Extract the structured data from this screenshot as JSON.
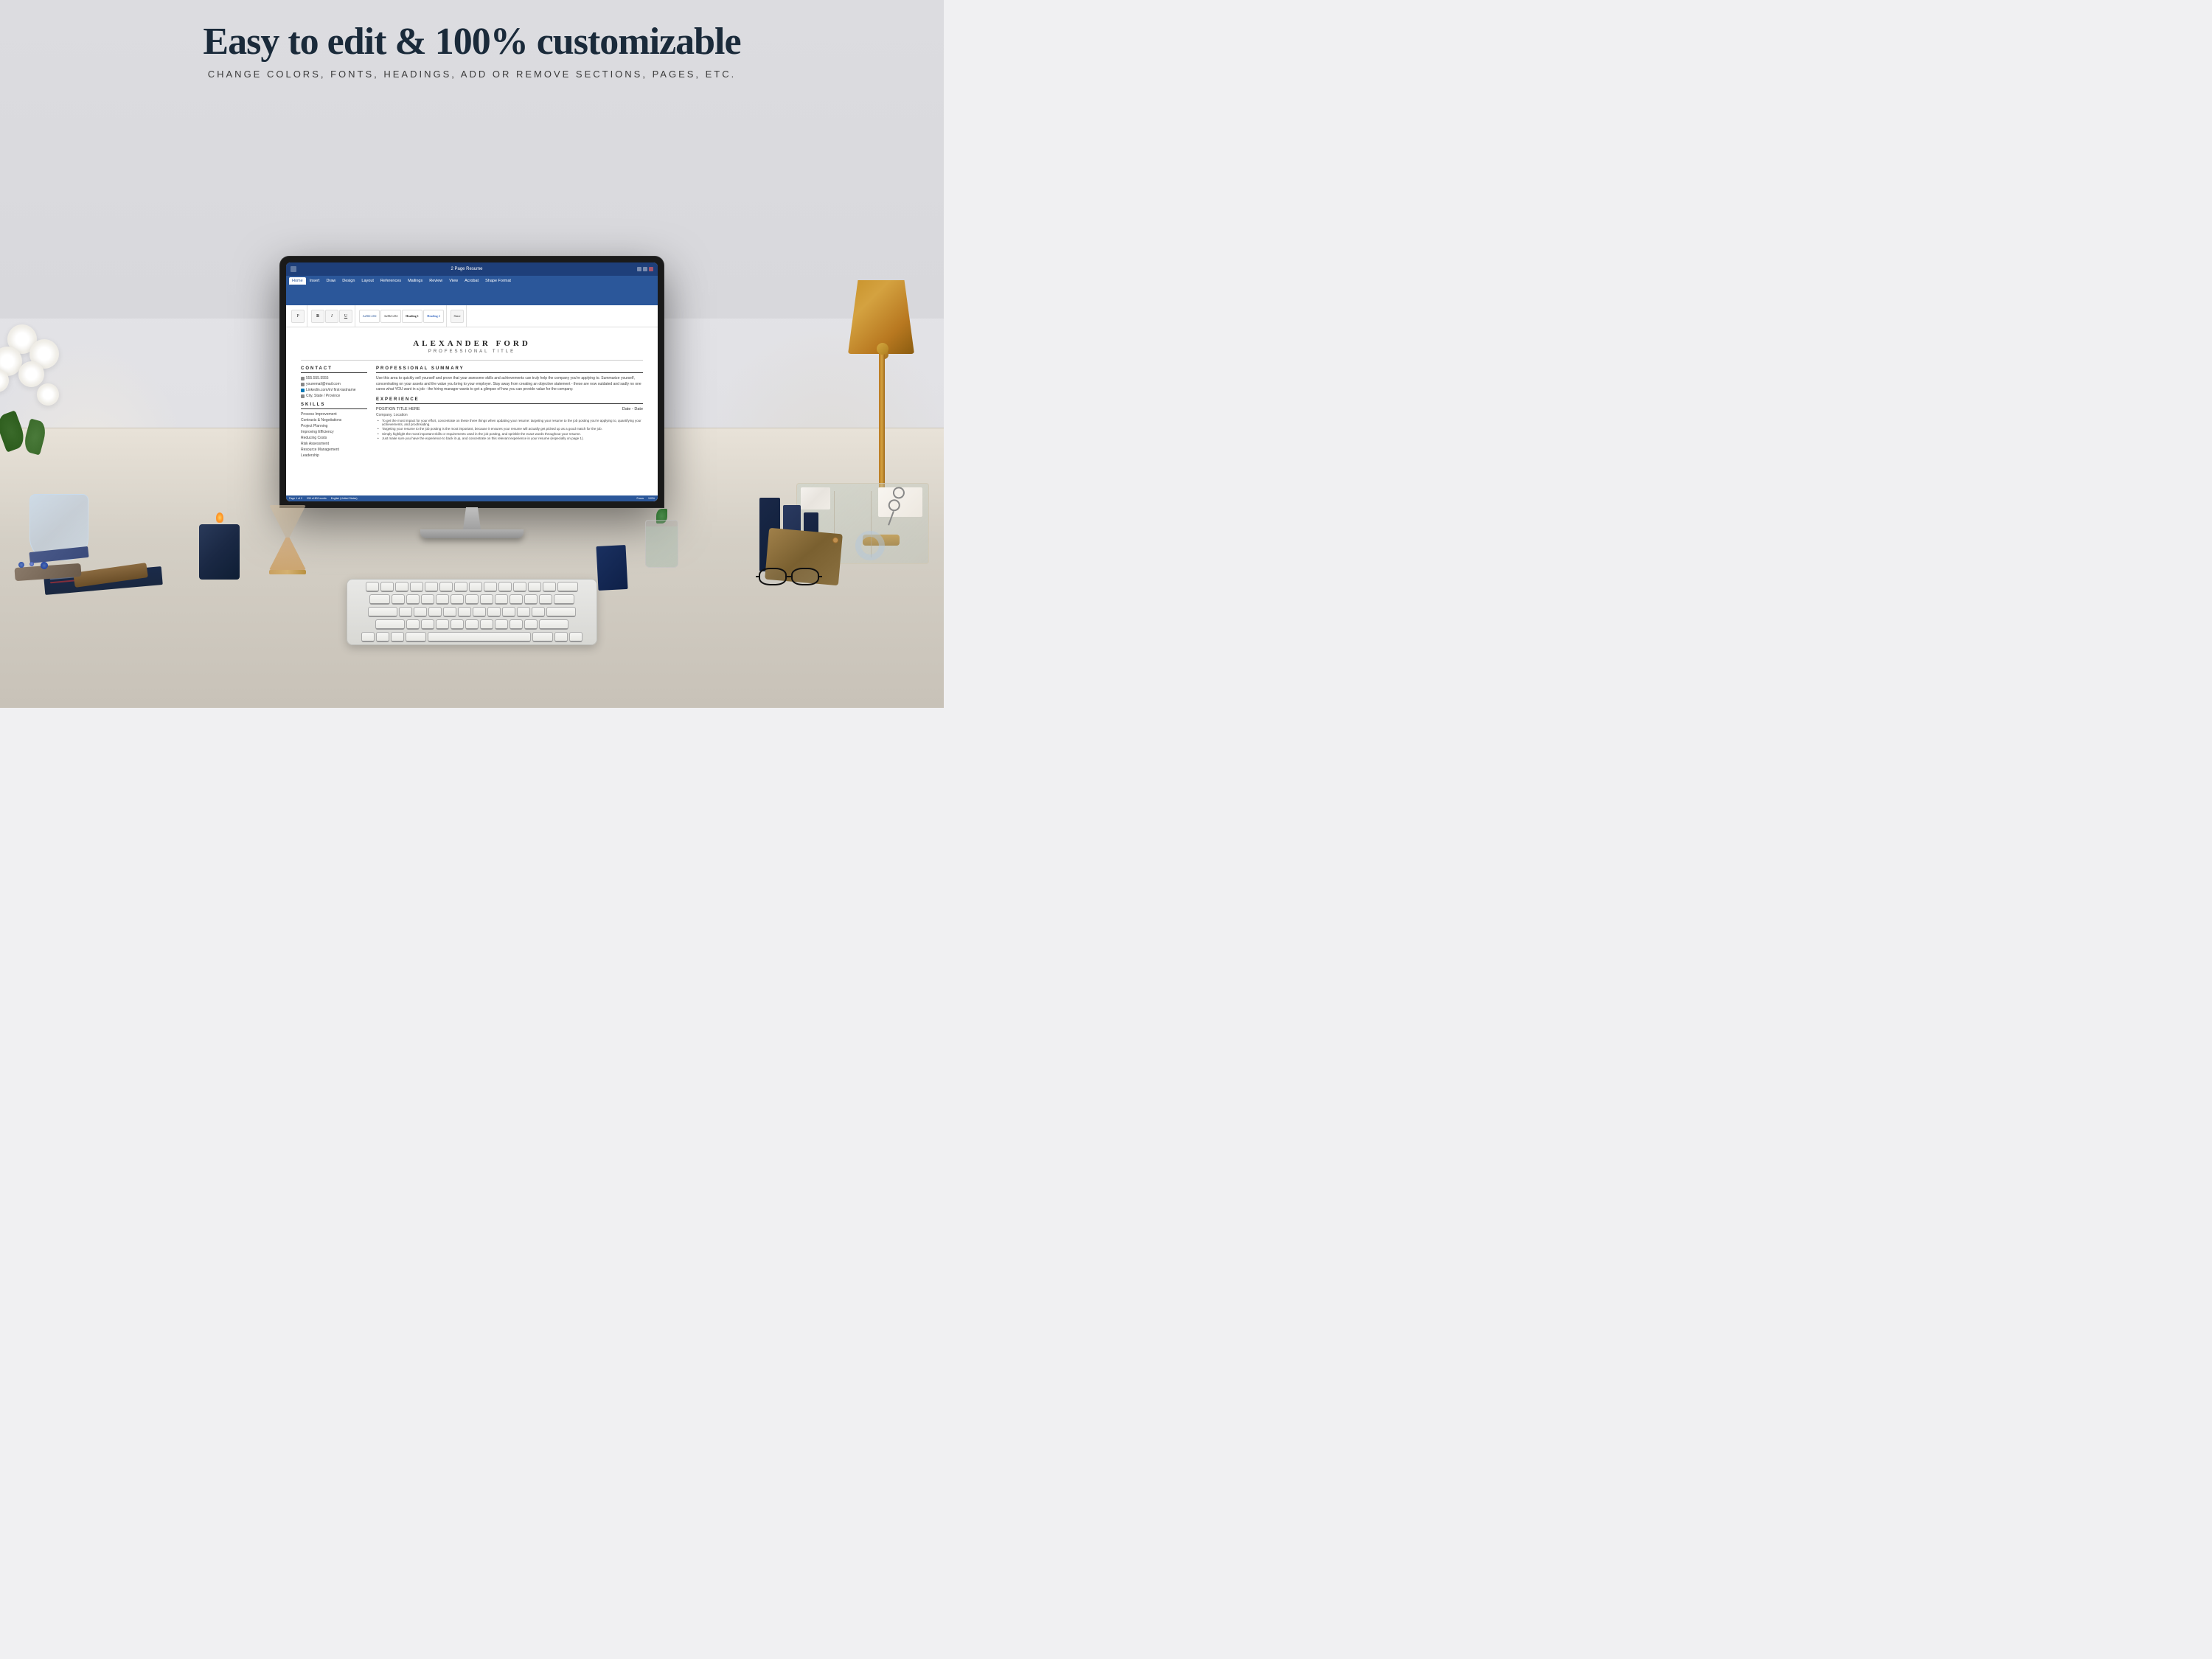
{
  "header": {
    "main_heading": "Easy to edit & 100% customizable",
    "sub_heading": "CHANGE COLORS, FONTS, HEADINGS, ADD or REMOVE SECTIONS, PAGES, etc."
  },
  "resume": {
    "name": "ALEXANDER FORD",
    "title": "PROFESSIONAL TITLE",
    "contact": {
      "label": "CONTACT",
      "phone": "555.555.5555",
      "email": "youremail@mail.com",
      "linkedin": "Linkedin.com/in/ first-lastname",
      "location": "City, State / Province"
    },
    "skills": {
      "label": "SKILLS",
      "items": [
        "Process Improvement",
        "Contracts & Negotiations",
        "Project Planning",
        "Improving Efficiency",
        "Reducing Costs",
        "Risk Assessment",
        "Resource Management",
        "Leadership"
      ]
    },
    "summary": {
      "label": "PROFESSIONAL SUMMARY",
      "text": "Use this area to quickly sell yourself and prove that your awesome skills and achievements can truly help the company you're applying to. Summarize yourself, concentrating on your assets and the value you bring to your employer. Stay away from creating an objective statement - these are now outdated and sadly no one cares what YOU want in a job - the hiring manager wants to get a glimpse of how you can provide value for the company."
    },
    "experience": {
      "label": "EXPERIENCE",
      "position": "POSITION TITLE HERE",
      "date": "Date - Date",
      "company": "Company, Location",
      "bullets": [
        "To get the most impact for your effort, concentrate on these three things when updating your resume: targeting your resume to the job posting you're applying to, quantifying your achievements, and proofreading.",
        "Targeting your resume to the job posting is the most important, because it ensures your resume will actually get picked up as a good match for the job.",
        "Simply highlight the most important skills or requirements used in the job posting, and sprinkle the exact words throughout your resume.",
        "Just make sure you have the experience to back it up, and concentrate on this relevant experience in your resume (especially on page 1)."
      ]
    }
  },
  "word_ui": {
    "title": "2 Page Resume",
    "tabs": [
      "Home",
      "Insert",
      "Draw",
      "Design",
      "Layout",
      "References",
      "Mailings",
      "Review",
      "View",
      "Acrobat",
      "Shape Format"
    ],
    "active_tab": "Home",
    "status": {
      "page": "Page 1 of 2",
      "words": "333 of 802 words",
      "language": "English (United States)"
    }
  },
  "colors": {
    "background": "#e8e8ec",
    "word_blue": "#2b579a",
    "desk_surface": "#e2dcd0",
    "lamp_gold": "#c89030",
    "navy_book": "#1a2848",
    "dark_candle": "#1e2e48"
  }
}
